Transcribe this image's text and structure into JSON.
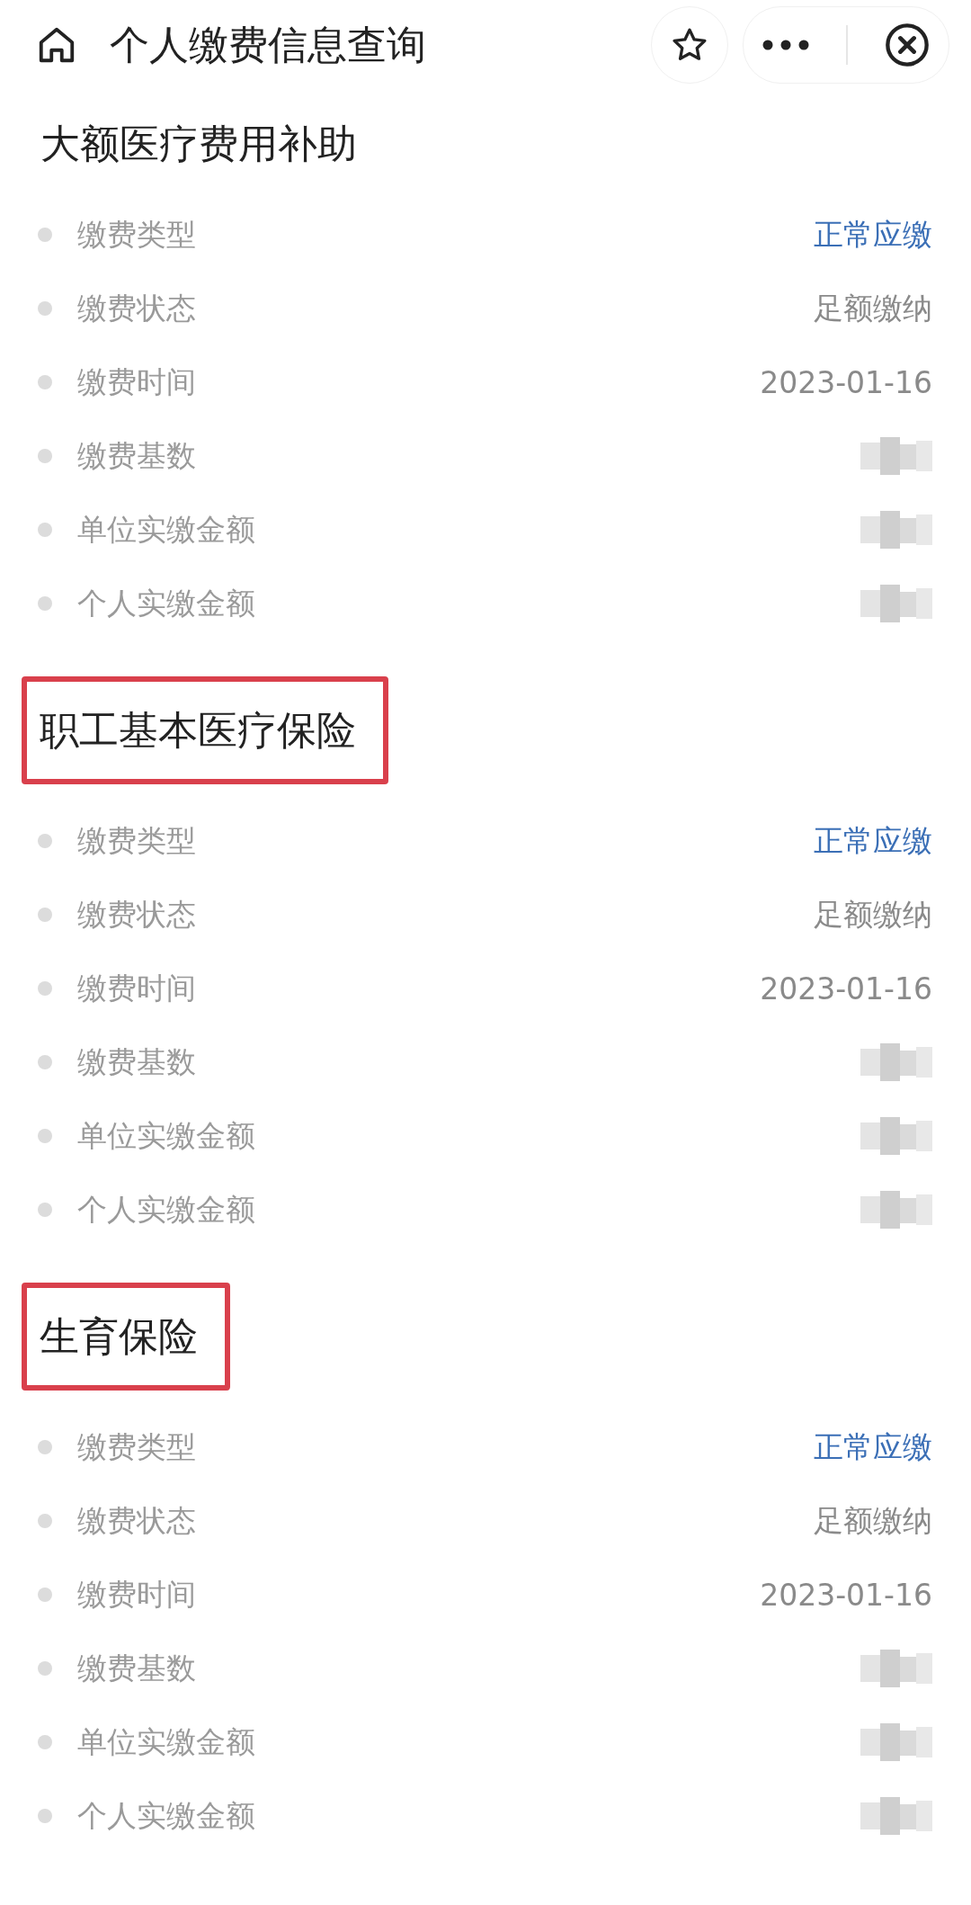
{
  "header": {
    "title": "个人缴费信息查询"
  },
  "sections": [
    {
      "title": "大额医疗费用补助",
      "highlighted": false,
      "rows": [
        {
          "label": "缴费类型",
          "kind": "accent",
          "value": "正常应缴"
        },
        {
          "label": "缴费状态",
          "kind": "plain",
          "value": "足额缴纳"
        },
        {
          "label": "缴费时间",
          "kind": "plain",
          "value": "2023-01-16"
        },
        {
          "label": "缴费基数",
          "kind": "redacted"
        },
        {
          "label": "单位实缴金额",
          "kind": "redacted"
        },
        {
          "label": "个人实缴金额",
          "kind": "redacted"
        }
      ]
    },
    {
      "title": "职工基本医疗保险",
      "highlighted": true,
      "rows": [
        {
          "label": "缴费类型",
          "kind": "accent",
          "value": "正常应缴"
        },
        {
          "label": "缴费状态",
          "kind": "plain",
          "value": "足额缴纳"
        },
        {
          "label": "缴费时间",
          "kind": "plain",
          "value": "2023-01-16"
        },
        {
          "label": "缴费基数",
          "kind": "redacted"
        },
        {
          "label": "单位实缴金额",
          "kind": "redacted"
        },
        {
          "label": "个人实缴金额",
          "kind": "redacted"
        }
      ]
    },
    {
      "title": "生育保险",
      "highlighted": true,
      "rows": [
        {
          "label": "缴费类型",
          "kind": "accent",
          "value": "正常应缴"
        },
        {
          "label": "缴费状态",
          "kind": "plain",
          "value": "足额缴纳"
        },
        {
          "label": "缴费时间",
          "kind": "plain",
          "value": "2023-01-16"
        },
        {
          "label": "缴费基数",
          "kind": "redacted"
        },
        {
          "label": "单位实缴金额",
          "kind": "redacted"
        },
        {
          "label": "个人实缴金额",
          "kind": "redacted"
        }
      ]
    }
  ]
}
